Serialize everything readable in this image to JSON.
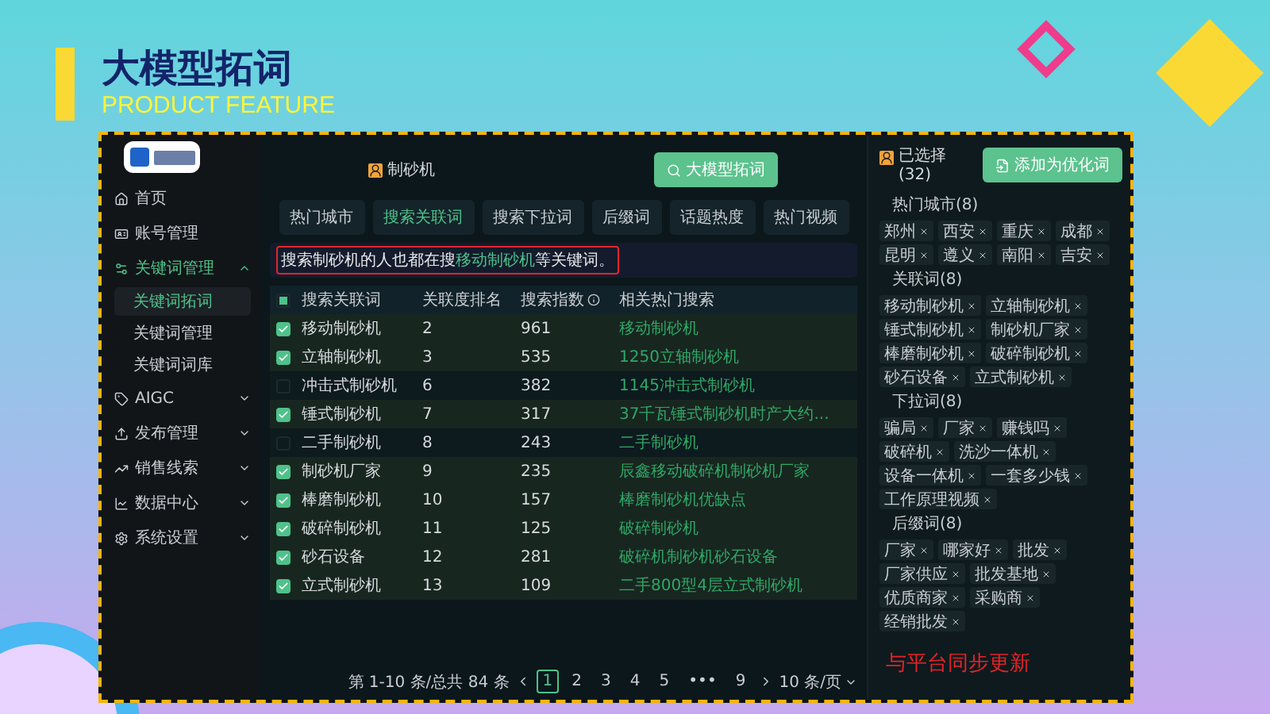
{
  "header": {
    "title": "大模型拓词",
    "subtitle": "PRODUCT FEATURE"
  },
  "sidebar": {
    "items": [
      {
        "label": "首页",
        "kind": "link"
      },
      {
        "label": "账号管理",
        "kind": "link"
      },
      {
        "label": "关键词管理",
        "kind": "group",
        "expanded": true,
        "children": [
          {
            "label": "关键词拓词",
            "selected": true
          },
          {
            "label": "关键词管理",
            "selected": false
          },
          {
            "label": "关键词词库",
            "selected": false
          }
        ]
      },
      {
        "label": "AIGC",
        "kind": "group",
        "expanded": false
      },
      {
        "label": "发布管理",
        "kind": "group",
        "expanded": false
      },
      {
        "label": "销售线索",
        "kind": "group",
        "expanded": false
      },
      {
        "label": "数据中心",
        "kind": "group",
        "expanded": false
      },
      {
        "label": "系统设置",
        "kind": "group",
        "expanded": false
      }
    ]
  },
  "search": {
    "keyword": "制砂机",
    "button": "大模型拓词"
  },
  "tabs": [
    {
      "label": "热门城市",
      "selected": false
    },
    {
      "label": "搜索关联词",
      "selected": true
    },
    {
      "label": "搜索下拉词",
      "selected": false
    },
    {
      "label": "后缀词",
      "selected": false
    },
    {
      "label": "话题热度",
      "selected": false
    },
    {
      "label": "热门视频",
      "selected": false
    }
  ],
  "notice": {
    "before": "搜索制砂机的人也都在搜",
    "highlight": "移动制砂机",
    "after": "等关键词。"
  },
  "table": {
    "select_all_partial": true,
    "columns": [
      "搜索关联词",
      "关联度排名",
      "搜索指数",
      "相关热门搜索"
    ],
    "rows": [
      {
        "checked": true,
        "cells": [
          "移动制砂机",
          "2",
          "961",
          "移动制砂机"
        ]
      },
      {
        "checked": true,
        "cells": [
          "立轴制砂机",
          "3",
          "535",
          "1250立轴制砂机"
        ]
      },
      {
        "checked": false,
        "cells": [
          "冲击式制砂机",
          "6",
          "382",
          "1145冲击式制砂机"
        ]
      },
      {
        "checked": true,
        "cells": [
          "锤式制砂机",
          "7",
          "317",
          "37千瓦锤式制砂机时产大约..."
        ]
      },
      {
        "checked": false,
        "cells": [
          "二手制砂机",
          "8",
          "243",
          "二手制砂机"
        ]
      },
      {
        "checked": true,
        "cells": [
          "制砂机厂家",
          "9",
          "235",
          "辰鑫移动破碎机制砂机厂家"
        ]
      },
      {
        "checked": true,
        "cells": [
          "棒磨制砂机",
          "10",
          "157",
          "棒磨制砂机优缺点"
        ]
      },
      {
        "checked": true,
        "cells": [
          "破碎制砂机",
          "11",
          "125",
          "破碎制砂机"
        ]
      },
      {
        "checked": true,
        "cells": [
          "砂石设备",
          "12",
          "281",
          "破碎机制砂机砂石设备"
        ]
      },
      {
        "checked": true,
        "cells": [
          "立式制砂机",
          "13",
          "109",
          "二手800型4层立式制砂机"
        ]
      }
    ]
  },
  "pagination": {
    "summary": "第 1-10 条/总共 84 条",
    "pages": [
      {
        "label": "1",
        "selected": true
      },
      {
        "label": "2",
        "selected": false
      },
      {
        "label": "3",
        "selected": false
      },
      {
        "label": "4",
        "selected": false
      },
      {
        "label": "5",
        "selected": false
      },
      {
        "label": "•••",
        "selected": false
      },
      {
        "label": "9",
        "selected": false
      }
    ],
    "page_size": "10 条/页"
  },
  "selection": {
    "title": "已选择",
    "count": "(32)",
    "button": "添加为优化词",
    "groups": [
      {
        "title": "热门城市(8)",
        "tags": [
          "郑州",
          "西安",
          "重庆",
          "成都",
          "昆明",
          "遵义",
          "南阳",
          "吉安"
        ]
      },
      {
        "title": "关联词(8)",
        "tags": [
          "移动制砂机",
          "立轴制砂机",
          "锤式制砂机",
          "制砂机厂家",
          "棒磨制砂机",
          "破碎制砂机",
          "砂石设备",
          "立式制砂机"
        ]
      },
      {
        "title": "下拉词(8)",
        "tags": [
          "骗局",
          "厂家",
          "赚钱吗",
          "破碎机",
          "洗沙一体机",
          "设备一体机",
          "一套多少钱",
          "工作原理视频"
        ]
      },
      {
        "title": "后缀词(8)",
        "tags": [
          "厂家",
          "哪家好",
          "批发",
          "厂家供应",
          "批发基地",
          "优质商家",
          "采购商",
          "经销批发"
        ]
      }
    ]
  },
  "footer_note": "与平台同步更新"
}
